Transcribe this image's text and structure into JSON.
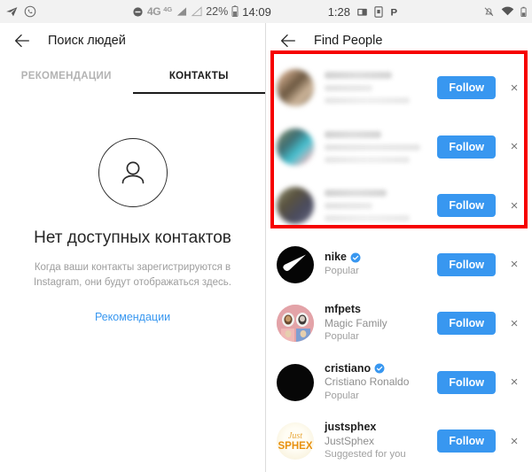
{
  "statusbar": {
    "left_icons": [
      "telegram-icon",
      "whatsapp-icon"
    ],
    "dnd_icon": "do-not-disturb-icon",
    "network": "4G",
    "network_small": "4G",
    "battery_percent": "22%",
    "time": "14:09",
    "secondary_time": "1:28",
    "tray_icons": [
      "screenshot-icon",
      "sim-card-icon",
      "parking-p-icon"
    ],
    "right_icons": [
      "mute-bell-icon",
      "wifi-icon",
      "battery-icon"
    ]
  },
  "left_panel": {
    "back_icon": "back-arrow-icon",
    "title": "Поиск людей",
    "tabs": [
      {
        "label": "РЕКОМЕНДАЦИИ",
        "active": false
      },
      {
        "label": "КОНТАКТЫ",
        "active": true
      }
    ],
    "empty_state": {
      "icon": "person-outline-icon",
      "title": "Нет доступных контактов",
      "subtitle": "Когда ваши контакты зарегистрируются в Instagram, они будут отображаться здесь.",
      "link": "Рекомендации"
    }
  },
  "right_panel": {
    "back_icon": "back-arrow-icon",
    "title": "Find People",
    "follow_label": "Follow",
    "close_icon": "×",
    "highlight_color": "#f60000",
    "accent_color": "#3897f0",
    "redacted_rows": [
      {
        "avatar": "blurred-avatar",
        "name": "redacted",
        "full_name": "redacted",
        "note": "redacted"
      },
      {
        "avatar": "blurred-avatar",
        "name": "redacted",
        "full_name": "redacted",
        "note": "redacted"
      },
      {
        "avatar": "blurred-avatar",
        "name": "redacted",
        "full_name": "redacted",
        "note": "redacted"
      }
    ],
    "suggestions": [
      {
        "username": "nike",
        "verified": true,
        "full_name": "",
        "note": "Popular",
        "avatar": "nike-logo-avatar"
      },
      {
        "username": "mfpets",
        "verified": false,
        "full_name": "Magic Family",
        "note": "Popular",
        "avatar": "guinea-pigs-photo-avatar"
      },
      {
        "username": "cristiano",
        "verified": true,
        "full_name": "Cristiano Ronaldo",
        "note": "Popular",
        "avatar": "cristiano-photo-avatar"
      },
      {
        "username": "justsphex",
        "verified": false,
        "full_name": "JustSphex",
        "note": "Suggested for you",
        "avatar": "justsphex-logo-avatar"
      }
    ]
  }
}
